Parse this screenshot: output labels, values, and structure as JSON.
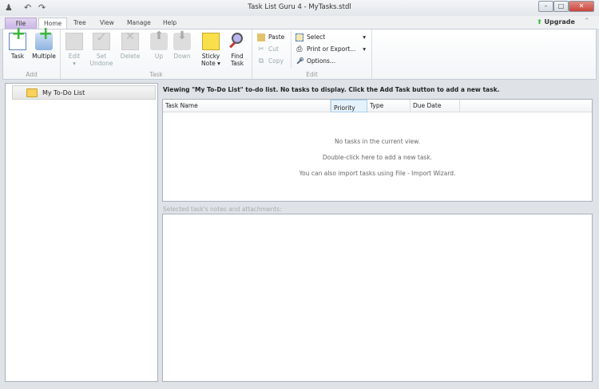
{
  "window": {
    "title": "Task List Guru 4 - MyTasks.stdl",
    "minimize": "–",
    "maximize": "□",
    "close": "✕"
  },
  "tabs": [
    "File",
    "Home",
    "Tree",
    "View",
    "Manage",
    "Help"
  ],
  "upgrade": "Upgrade",
  "ribbon": {
    "add": {
      "label": "Add",
      "task": "Task",
      "multiple": "Multiple"
    },
    "task": {
      "label": "Task",
      "edit": "Edit",
      "set_undone_1": "Set",
      "set_undone_2": "Undone",
      "delete": "Delete",
      "up": "Up",
      "down": "Down",
      "sticky_1": "Sticky",
      "sticky_2": "Note",
      "find_1": "Find",
      "find_2": "Task"
    },
    "edit": {
      "label": "Edit",
      "paste": "Paste",
      "cut": "Cut",
      "copy": "Copy",
      "select": "Select",
      "print": "Print or Export...",
      "options": "Options..."
    }
  },
  "tree": {
    "items": [
      {
        "label": "My To-Do List"
      }
    ]
  },
  "main": {
    "message": "Viewing \"My To-Do List\" to-do list. No tasks to display. Click the Add Task button to add a new task.",
    "columns": [
      "Task Name",
      "Priority",
      "Type",
      "Due Date"
    ],
    "empty": [
      "No tasks in the current view.",
      "Double-click here to add a new task.",
      "You can also import tasks using File - Import Wizard."
    ],
    "notes_label": "Selected task's notes and attachments:"
  },
  "colors": {
    "accent_green": "#3cb83c",
    "file_tab": "#c9b6e6",
    "close": "#c9463d"
  }
}
